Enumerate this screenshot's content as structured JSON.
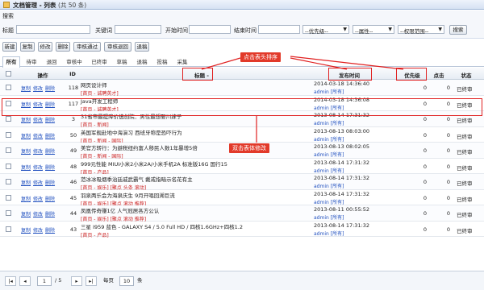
{
  "titlebar": {
    "title": "文档管理 - 列表",
    "count": "(共 50 条)"
  },
  "search": {
    "title": "搜索",
    "labels": {
      "title": "标题",
      "keyword": "关键词",
      "start": "开始时间",
      "end": "结束时间"
    },
    "selects": {
      "priority": "--优先级--",
      "attribute": "--属性--",
      "permission": "--权限范围--"
    },
    "button": "搜索"
  },
  "toolbar": [
    "新建",
    "复制",
    "修改",
    "删除",
    "审核通过",
    "审核退回",
    "退稿"
  ],
  "tabs": [
    "所有",
    "待审",
    "退回",
    "审核中",
    "已终审",
    "草稿",
    "退稿",
    "投稿",
    "采集"
  ],
  "grid": {
    "headers": {
      "ops": "操作",
      "id": "ID",
      "title": "标题 -",
      "time": "发布时间",
      "priority": "优先级",
      "hits": "点击",
      "status": "状态"
    },
    "op_labels": [
      "复制",
      "修改",
      "删除"
    ],
    "rows": [
      {
        "id": "118",
        "title": "网页设计师",
        "category": "[首页 - 诚聘英才]",
        "time": "2014-03-18 14:36:40",
        "author": "admin",
        "perm": "[所有]",
        "priority": "0",
        "hits": "0",
        "status": "已终审"
      },
      {
        "id": "117",
        "title": "Java开发工程师",
        "category": "[首页 - 诚聘英才]",
        "time": "2014-03-18 14:36:08",
        "author": "admin",
        "perm": "[所有]",
        "priority": "0",
        "hits": "0",
        "status": "已终审"
      },
      {
        "id": "3",
        "title": "31省市最提降价选创院：男性最想娶川妹子",
        "category": "[首页 - 新闻]",
        "time": "2013-08-14 17:31:32",
        "author": "admin",
        "perm": "[所有]",
        "priority": "0",
        "hits": "0",
        "status": "已终审"
      },
      {
        "id": "50",
        "title": "英国军舰赴地中海演习 西班牙称是恐吓行为",
        "category": "[首页 - 新闻 - 国际]",
        "time": "2013-08-13 08:03:00",
        "author": "admin",
        "perm": "[所有]",
        "priority": "0",
        "hits": "0",
        "status": "已终审"
      },
      {
        "id": "49",
        "title": "美官方转行：为避税纽约富人移民人数1年暴增5倍",
        "category": "[首页 - 新闻 - 国际]",
        "time": "2013-08-13 08:02:05",
        "author": "admin",
        "perm": "[所有]",
        "priority": "0",
        "hits": "0",
        "status": "已终审"
      },
      {
        "id": "48",
        "title": "999元性能 MIUI小米2小米2A/小米手机2A 标准版16G 国行15",
        "category": "[首页 - 产品]",
        "time": "2013-08-14 17:31:32",
        "author": "admin",
        "perm": "[所有]",
        "priority": "0",
        "hits": "0",
        "status": "已终审"
      },
      {
        "id": "46",
        "title": "范冰冰吸烟季治廷戚武霸气 戴戒指暗示名花有主",
        "category": "[首页 - 娱乐] [聚点 头条 滚动]",
        "time": "2013-08-14 17:31:32",
        "author": "admin",
        "perm": "[所有]",
        "priority": "0",
        "hits": "0",
        "status": "已终审"
      },
      {
        "id": "45",
        "title": "羽泉两乐会为海泉庆生 9月开唱回溯巨流",
        "category": "[首页 - 娱乐] [聚点 滚动 推荐]",
        "time": "2013-08-14 17:31:32",
        "author": "admin",
        "perm": "[所有]",
        "priority": "0",
        "hits": "0",
        "status": "已终审"
      },
      {
        "id": "44",
        "title": "凤凰传奇赚1亿 人气冠居各方公认",
        "category": "[首页 - 娱乐] [聚点 滚动 推荐]",
        "time": "2013-08-11 00:55:52",
        "author": "admin",
        "perm": "[所有]",
        "priority": "0",
        "hits": "0",
        "status": "已终审"
      },
      {
        "id": "43",
        "title": "三星 I959 蓝色 - GALAXY S4 / 5.0 Full HD / 四核1.6GHz+四核1.2",
        "category": "[首页 - 产品]",
        "time": "2013-08-14 17:31:32",
        "author": "admin",
        "perm": "[所有]",
        "priority": "0",
        "hits": "0",
        "status": "已终审"
      }
    ]
  },
  "pager": {
    "page": "1",
    "total": "/ 5",
    "per_page_label": "每页",
    "per_page": "10",
    "unit": "条"
  },
  "annotations": {
    "sort": "点击表头排序",
    "edit": "双击表体修改"
  },
  "colors": {
    "accent": "#1f4fbf",
    "annotation": "#e23a2a",
    "category": "#cc2222"
  }
}
